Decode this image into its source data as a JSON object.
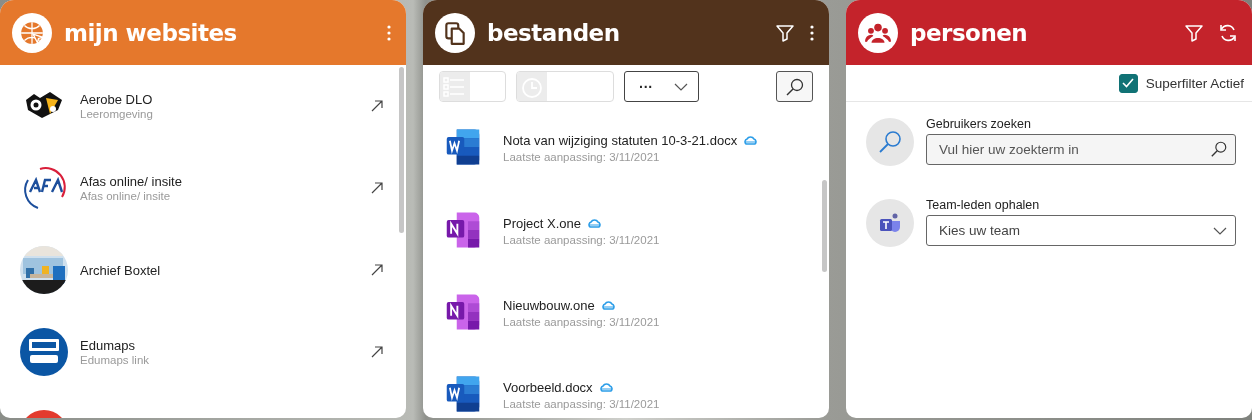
{
  "panels": [
    {
      "kind": "websites",
      "title": "mijn websites",
      "color": "#e5782c",
      "items": [
        {
          "kind": "owl",
          "name": "Aerobe DLO",
          "subtitle": "Leeromgeving"
        },
        {
          "kind": "afas",
          "name": "Afas online/ insite",
          "subtitle": "Afas online/ insite"
        },
        {
          "kind": "picture",
          "name": "Archief Boxtel"
        },
        {
          "kind": "datacare",
          "name": "Edumaps",
          "subtitle": "Edumaps link"
        },
        {
          "kind": "target"
        }
      ]
    },
    {
      "kind": "files",
      "title": "bestanden",
      "color": "#52331c",
      "sort": "···",
      "files": [
        {
          "kind": "word",
          "name": "Nota van wijziging statuten 10-3-21.docx",
          "modified": "Laatste aanpassing: 3/11/2021"
        },
        {
          "kind": "onenote",
          "name": "Project X.one",
          "modified": "Laatste aanpassing: 3/11/2021"
        },
        {
          "kind": "onenote",
          "name": "Nieuwbouw.one",
          "modified": "Laatste aanpassing: 3/11/2021"
        },
        {
          "kind": "word",
          "name": "Voorbeeld.docx",
          "modified": "Laatste aanpassing: 3/11/2021"
        }
      ]
    },
    {
      "kind": "people",
      "title": "personen",
      "color": "#c4232b",
      "superfilter": {
        "label": "Superfilter Actief",
        "checked": true
      },
      "search": {
        "label": "Gebruikers zoeken",
        "placeholder": "Vul hier uw zoekterm in"
      },
      "team": {
        "label": "Team-leden ophalen",
        "placeholder": "Kies uw team"
      }
    }
  ]
}
